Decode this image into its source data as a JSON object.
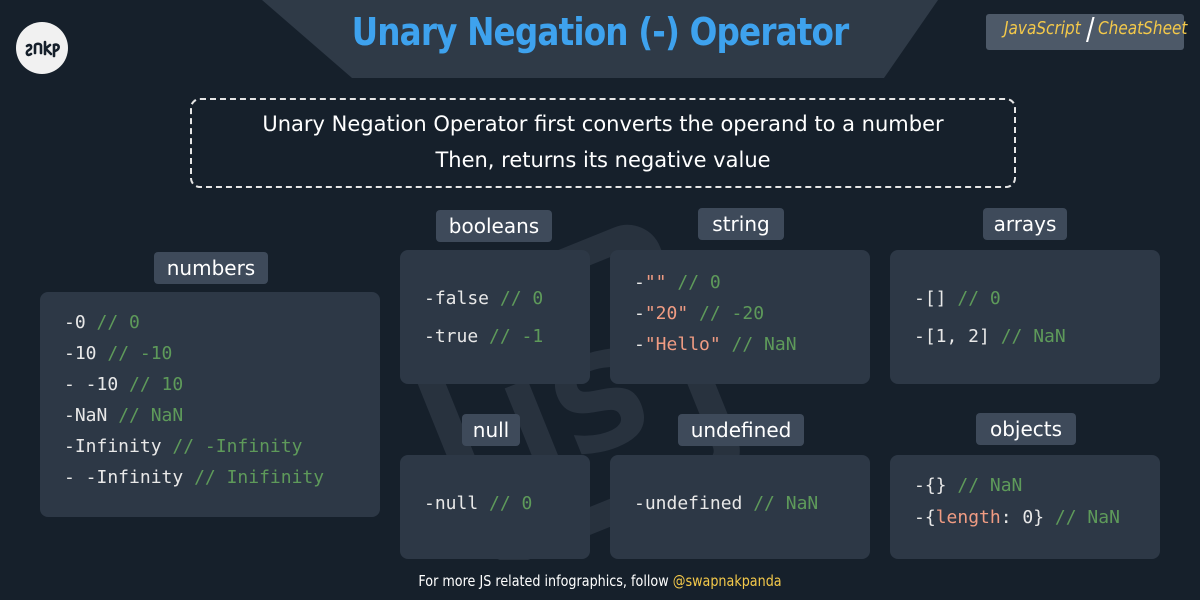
{
  "header": {
    "title": "Unary Negation (-) Operator",
    "badge_left": "JavaScript",
    "badge_slash": "/",
    "badge_right": "CheatSheet"
  },
  "info": {
    "line1": "Unary Negation Operator first converts the operand to a number",
    "line2": "Then, returns its negative value"
  },
  "sections": {
    "numbers": {
      "label": "numbers",
      "lines": [
        {
          "code": "-0",
          "comment": "// 0"
        },
        {
          "code": "-10",
          "comment": "// -10"
        },
        {
          "code": "- -10",
          "comment": "// 10"
        },
        {
          "code": "-NaN",
          "comment": "// NaN"
        },
        {
          "code": "-Infinity",
          "comment": "// -Infinity"
        },
        {
          "code": "- -Infinity",
          "comment": "// Inifinity"
        }
      ]
    },
    "booleans": {
      "label": "booleans",
      "lines": [
        {
          "code": "-false",
          "comment": "// 0"
        },
        {
          "code": "-true",
          "comment": "// -1"
        }
      ]
    },
    "string": {
      "label": "string",
      "lines": [
        {
          "prefix": "-",
          "str": "\"\"",
          "comment": "// 0"
        },
        {
          "prefix": "-",
          "str": "\"20\"",
          "comment": "// -20"
        },
        {
          "prefix": "-",
          "str": "\"Hello\"",
          "comment": "// NaN"
        }
      ]
    },
    "arrays": {
      "label": "arrays",
      "lines": [
        {
          "code": "-[]",
          "comment": "// 0"
        },
        {
          "code": "-[1, 2]",
          "comment": "// NaN"
        }
      ]
    },
    "null": {
      "label": "null",
      "lines": [
        {
          "code": "-null",
          "comment": "// 0"
        }
      ]
    },
    "undefined": {
      "label": "undefined",
      "lines": [
        {
          "code": "-undefined",
          "comment": "// NaN"
        }
      ]
    },
    "objects": {
      "label": "objects",
      "lines": [
        {
          "code": "-{}",
          "comment": "// NaN"
        },
        {
          "open": "-{",
          "key": "length",
          "rest": ": 0}",
          "comment": "// NaN"
        }
      ]
    }
  },
  "footer": {
    "text": "For more JS related infographics, follow ",
    "handle": "@swapnakpanda"
  },
  "logo": {
    "icon": "snp-logo-icon"
  },
  "colors": {
    "background": "#16202b",
    "title": "#3ea2ee",
    "accent": "#f4c94a",
    "card": "#2d3846",
    "label": "#3e4a5a",
    "comment": "#5e9a5a",
    "string": "#f09c83"
  }
}
